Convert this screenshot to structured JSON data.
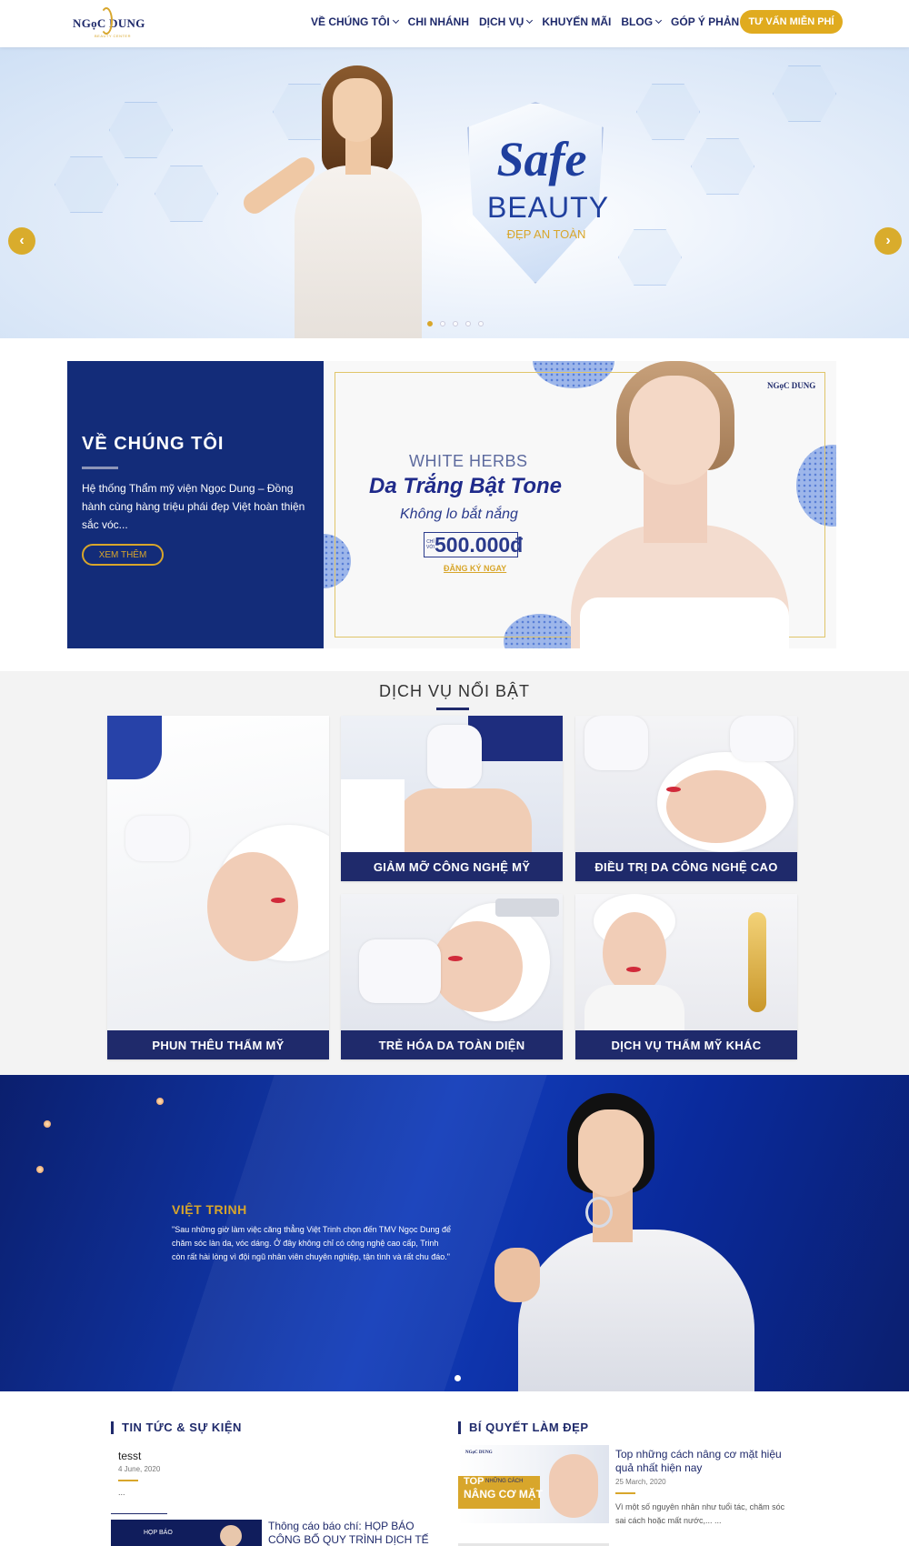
{
  "brand": {
    "name": "NGọC DUNG",
    "tagline": "BEAUTY CENTER"
  },
  "nav": {
    "items": [
      {
        "label": "VỀ CHÚNG TÔI",
        "has_dropdown": true
      },
      {
        "label": "CHI NHÁNH",
        "has_dropdown": false
      },
      {
        "label": "DỊCH VỤ",
        "has_dropdown": true
      },
      {
        "label": "KHUYẾN MÃI",
        "has_dropdown": false
      },
      {
        "label": "BLOG",
        "has_dropdown": true
      },
      {
        "label": "GÓP Ý PHẢN HỒI",
        "has_dropdown": false
      }
    ],
    "cta": "TƯ VẤN MIỄN PHÍ"
  },
  "hero": {
    "headline": "Safe",
    "headline2": "BEAUTY",
    "subline": "ĐẸP AN TOÀN",
    "prev_icon": "chevron-left-icon",
    "next_icon": "chevron-right-icon",
    "slide_count": 5,
    "active_slide": 1
  },
  "about": {
    "title": "VỀ CHÚNG TÔI",
    "body": "Hệ thống Thẩm mỹ viện Ngọc Dung – Đồng hành cùng hàng triệu phái đẹp Việt hoàn thiện sắc vóc...",
    "button": "XEM THÊM"
  },
  "promo": {
    "logo": "NGọC DUNG",
    "line1": "WHITE HERBS",
    "line2": "Da Trắng Bật Tone",
    "line3": "Không lo bắt nắng",
    "price_prefix": "CHỈ VỚI",
    "price": "500.000đ",
    "link": "ĐĂNG KÝ NGAY"
  },
  "services": {
    "title": "DỊCH VỤ NỔI BẬT",
    "items": [
      {
        "label": "PHUN THÊU THẨM MỸ"
      },
      {
        "label": "GIẢM MỠ CÔNG NGHỆ MỸ"
      },
      {
        "label": "ĐIỀU TRỊ DA CÔNG NGHỆ CAO"
      },
      {
        "label": "TRẺ HÓA DA TOÀN DIỆN"
      },
      {
        "label": "DỊCH VỤ THẨM MỸ KHÁC"
      }
    ]
  },
  "testimonial": {
    "name": "VIỆT TRINH",
    "quote": "\"Sau những giờ làm việc căng thẳng Việt Trinh chọn đến TMV Ngọc Dung để chăm sóc làn da, vóc dáng. Ở đây không chỉ có công nghệ cao cấp, Trinh còn rất hài lòng vì đội ngũ nhân viên chuyên nghiệp, tận tình và rất chu đáo.\""
  },
  "news": {
    "title": "TIN TỨC & SỰ KIỆN",
    "items": [
      {
        "title": "tesst",
        "date": "4 June, 2020",
        "excerpt": "..."
      },
      {
        "title": "Thông cáo báo chí: HỌP BÁO CÔNG BỐ QUY TRÌNH DỊCH TẾ DO...",
        "thumb_label": "HỌP BÁO"
      }
    ]
  },
  "tips": {
    "title": "BÍ QUYẾT LÀM ĐẸP",
    "items": [
      {
        "title": "Top những cách nâng cơ mặt hiệu quả nhất hiện nay",
        "date": "25 March, 2020",
        "excerpt": "Vì một số nguyên nhân như tuổi tác, chăm sóc sai cách hoặc mất nước,... ...",
        "thumb_top": "TOP",
        "thumb_caption": "NÂNG CƠ MẶT",
        "thumb_small": "NHỮNG CÁCH"
      }
    ]
  },
  "colors": {
    "navy": "#1f2a6b",
    "gold": "#d8a62b",
    "royal_blue": "#123dba"
  }
}
